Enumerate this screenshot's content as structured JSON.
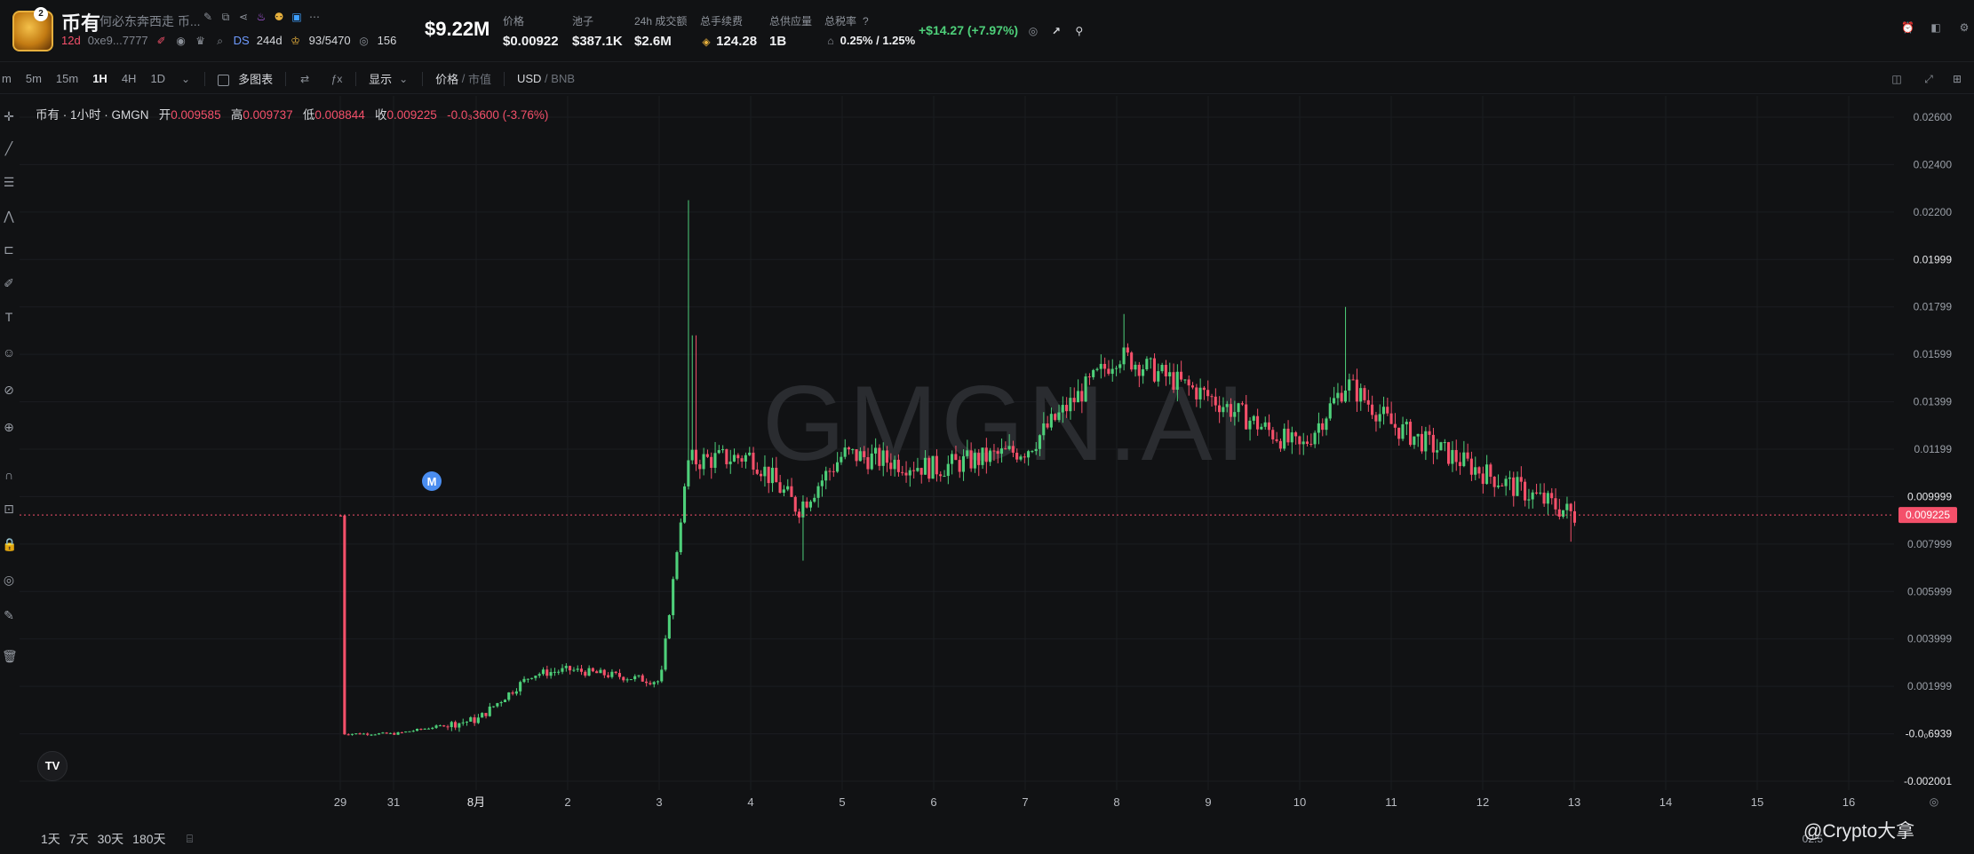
{
  "header": {
    "token_name": "币有",
    "token_subtitle": "何必东奔西走 币...",
    "logo_badge": "2",
    "age": "12d",
    "address": "0xe9...7777",
    "ds_label": "DS",
    "ds_age": "244d",
    "holders": "93/5470",
    "views": "156",
    "market_cap": "$9.22M",
    "stats": [
      {
        "label": "价格",
        "value": "$0.00922"
      },
      {
        "label": "池子",
        "value": "$387.1K"
      },
      {
        "label": "24h 成交额",
        "value": "$2.6M"
      },
      {
        "label": "总手续费",
        "value": "124.28"
      },
      {
        "label": "总供应量",
        "value": "1B"
      },
      {
        "label": "总税率",
        "value": "0.25% / 1.25%"
      }
    ],
    "change": "+$14.27 (+7.97%)"
  },
  "toolbar": {
    "timeframes": [
      "m",
      "5m",
      "15m",
      "1H",
      "4H",
      "1D"
    ],
    "active_timeframe": "1H",
    "multi_chart": "多图表",
    "display": "显示",
    "price_label": "价格",
    "mcap_label": "市值",
    "usd_label": "USD",
    "bnb_label": "BNB"
  },
  "legend": {
    "title": "币有 · 1小时 · GMGN",
    "open_label": "开",
    "open": "0.009585",
    "high_label": "高",
    "high": "0.009737",
    "low_label": "低",
    "low": "0.008844",
    "close_label": "收",
    "close": "0.009225",
    "change": "-0.0₃3600 (-3.76%)"
  },
  "watermark": "GMGN.AI",
  "bottom": {
    "ranges": [
      "1天",
      "7天",
      "30天",
      "180天"
    ],
    "time_partial": "02:5",
    "credit": "@Crypto大拿"
  },
  "chart_data": {
    "type": "candlestick",
    "title": "币有 · 1小时 · GMGN",
    "y_axis_labels": [
      "0.02600",
      "0.02400",
      "0.02200",
      "0.01999",
      "0.01799",
      "0.01599",
      "0.01399",
      "0.01199",
      "0.009999",
      "0.007999",
      "0.005999",
      "0.003999",
      "0.001999",
      "-0.0₀6939",
      "-0.002001"
    ],
    "y_range": [
      -0.002001,
      0.026
    ],
    "x_axis_labels": [
      "29",
      "31",
      "8月",
      "2",
      "3",
      "4",
      "5",
      "6",
      "7",
      "8",
      "9",
      "10",
      "11",
      "12",
      "13",
      "14",
      "15",
      "16"
    ],
    "current_price": "0.009225",
    "current_price_color": "#f4506a",
    "up_color": "#4ed07a",
    "down_color": "#f4506a",
    "marker": "M",
    "approx_path_by_day": [
      {
        "day": "29",
        "price": 0.0
      },
      {
        "day": "31",
        "price": 0.0
      },
      {
        "day": "8月",
        "price": 0.0006
      },
      {
        "day": "1",
        "price": 0.0025
      },
      {
        "day": "2",
        "price": 0.0027
      },
      {
        "day": "3",
        "price": 0.0022
      },
      {
        "day": "3.3",
        "price": 0.0115
      },
      {
        "day": "4",
        "price": 0.0117
      },
      {
        "day": "4.5",
        "price": 0.0095
      },
      {
        "day": "5",
        "price": 0.0118
      },
      {
        "day": "6",
        "price": 0.0112
      },
      {
        "day": "7",
        "price": 0.012
      },
      {
        "day": "8",
        "price": 0.016
      },
      {
        "day": "9",
        "price": 0.0142
      },
      {
        "day": "10",
        "price": 0.012
      },
      {
        "day": "10.5",
        "price": 0.0148
      },
      {
        "day": "11",
        "price": 0.013
      },
      {
        "day": "12",
        "price": 0.011
      },
      {
        "day": "13",
        "price": 0.0092
      }
    ]
  }
}
